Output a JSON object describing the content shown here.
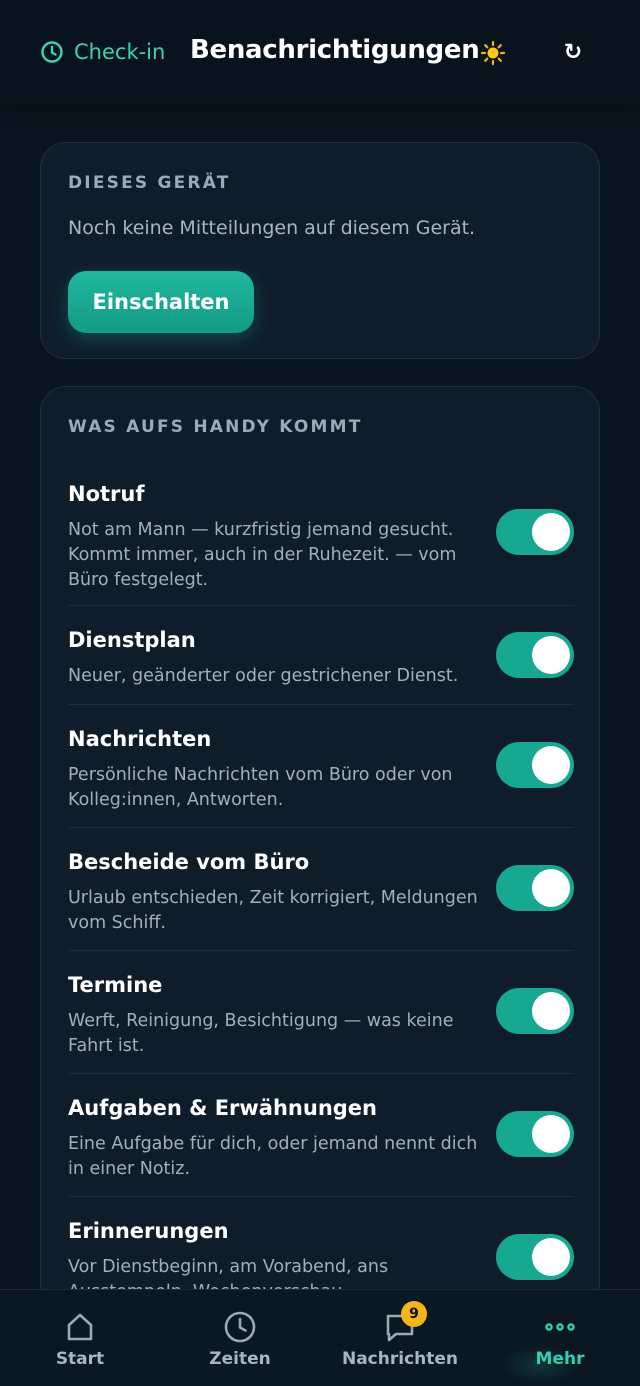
{
  "header": {
    "checkin_label": "Check-in",
    "title": "Benachrichtigungen",
    "theme_icon": "sun-icon",
    "refresh_icon": "refresh-icon",
    "refresh_glyph": "↻"
  },
  "device": {
    "section_title": "DIESES GERÄT",
    "status_text": "Noch keine Mitteilungen auf diesem Gerät.",
    "enable_label": "Einschalten"
  },
  "types": {
    "section_title": "WAS AUFS HANDY KOMMT",
    "items": [
      {
        "title": "Notruf",
        "desc": "Not am Mann — kurzfristig jemand gesucht. Kommt immer, auch in der Ruhezeit. — vom Büro festgelegt.",
        "enabled": true
      },
      {
        "title": "Dienstplan",
        "desc": "Neuer, geänderter oder gestrichener Dienst.",
        "enabled": true
      },
      {
        "title": "Nachrichten",
        "desc": "Persönliche Nachrichten vom Büro oder von Kolleg:innen, Antworten.",
        "enabled": true
      },
      {
        "title": "Bescheide vom Büro",
        "desc": "Urlaub entschieden, Zeit korrigiert, Meldungen vom Schiff.",
        "enabled": true
      },
      {
        "title": "Termine",
        "desc": "Werft, Reinigung, Besichtigung — was keine Fahrt ist.",
        "enabled": true
      },
      {
        "title": "Aufgaben & Erwähnungen",
        "desc": "Eine Aufgabe für dich, oder jemand nennt dich in einer Notiz.",
        "enabled": true
      },
      {
        "title": "Erinnerungen",
        "desc": "Vor Dienstbeginn, am Vorabend, ans Ausstempeln, Wochenvorschau.",
        "enabled": true
      }
    ]
  },
  "nav": {
    "items": [
      {
        "label": "Start",
        "icon": "home-icon"
      },
      {
        "label": "Zeiten",
        "icon": "clock-icon"
      },
      {
        "label": "Nachrichten",
        "icon": "chat-icon",
        "badge": "9"
      },
      {
        "label": "Mehr",
        "icon": "more-icon",
        "active": true
      }
    ]
  },
  "colors": {
    "accent": "#1fb89e",
    "background": "#0a1520",
    "card": "#0f1d2a",
    "badge": "#f2b61d"
  }
}
